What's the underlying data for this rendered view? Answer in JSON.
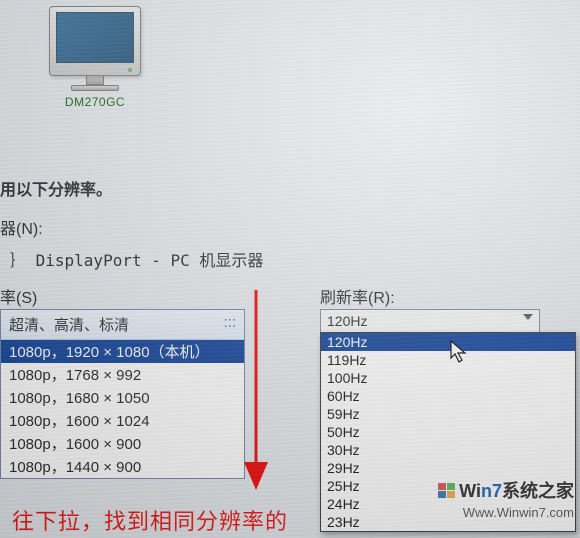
{
  "monitor": {
    "label": "DM270GC"
  },
  "labels": {
    "use_resolution": "用以下分辨率。",
    "device": "器(N):",
    "port_line": "｝  DisplayPort - PC 机显示器",
    "rate": "率(S)",
    "refresh": "刷新率(R):"
  },
  "resolution": {
    "header": "超清、高清、标清",
    "header_dots": ":::",
    "items": [
      {
        "text": "1080p，1920 × 1080（本机）",
        "selected": true
      },
      {
        "text": "1080p，1768 × 992",
        "selected": false
      },
      {
        "text": "1080p，1680 × 1050",
        "selected": false
      },
      {
        "text": "1080p，1600 × 1024",
        "selected": false
      },
      {
        "text": "1080p，1600 × 900",
        "selected": false
      },
      {
        "text": "1080p，1440 × 900",
        "selected": false
      }
    ]
  },
  "refresh_combo": {
    "selected": "120Hz"
  },
  "refresh_options": [
    {
      "text": "120Hz",
      "highlighted": true
    },
    {
      "text": "119Hz",
      "highlighted": false
    },
    {
      "text": "100Hz",
      "highlighted": false
    },
    {
      "text": "60Hz",
      "highlighted": false
    },
    {
      "text": "59Hz",
      "highlighted": false
    },
    {
      "text": "50Hz",
      "highlighted": false
    },
    {
      "text": "30Hz",
      "highlighted": false
    },
    {
      "text": "29Hz",
      "highlighted": false
    },
    {
      "text": "25Hz",
      "highlighted": false
    },
    {
      "text": "24Hz",
      "highlighted": false
    },
    {
      "text": "23Hz",
      "highlighted": false
    }
  ],
  "annotation": "往下拉，找到相同分辨率的",
  "watermark": {
    "line1_prefix": "Wi",
    "line1_mid": "n7",
    "line1_suffix": "系统之家",
    "line2": "Www.Winwin7.com"
  }
}
